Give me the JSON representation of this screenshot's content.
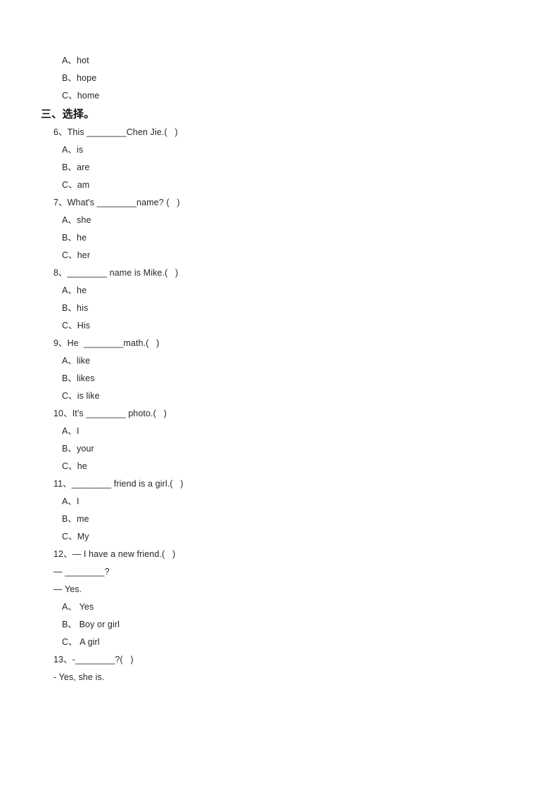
{
  "document": {
    "type": "exam-worksheet",
    "language": "zh-CN + en",
    "background_color": "#ffffff",
    "text_color": "#262626"
  },
  "carryover_options": {
    "note": "trailing options of previous question from preceding page",
    "items": [
      "A、hot",
      "B、hope",
      "C、home"
    ]
  },
  "section": {
    "heading": "三、选择。"
  },
  "questions": [
    {
      "stem": "6、This ________Chen Jie.(   )",
      "options": [
        "A、is",
        "B、are",
        "C、am"
      ]
    },
    {
      "stem": "7、What's ________name? (   )",
      "options": [
        "A、she",
        "B、he",
        "C、her"
      ]
    },
    {
      "stem": "8、________ name is Mike.(   )",
      "options": [
        "A、he",
        "B、his",
        "C、His"
      ]
    },
    {
      "stem": "9、He  ________math.(   )",
      "options": [
        "A、like",
        "B、likes",
        "C、is like"
      ]
    },
    {
      "stem": "10、It's ________ photo.(   )",
      "options": [
        "A、I",
        "B、your",
        "C、he"
      ]
    },
    {
      "stem": "11、________ friend is a girl.(   )",
      "options": [
        "A、I",
        "B、me",
        "C、My"
      ]
    },
    {
      "stem": "12、— I have a new friend.(   )",
      "extra_lines": [
        "— ________?",
        "— Yes."
      ],
      "options": [
        "A、 Yes",
        "B、 Boy or girl",
        "C、 A girl"
      ]
    },
    {
      "stem": "13、-________?(   )",
      "extra_lines": [
        "- Yes, she is."
      ],
      "options": []
    }
  ]
}
